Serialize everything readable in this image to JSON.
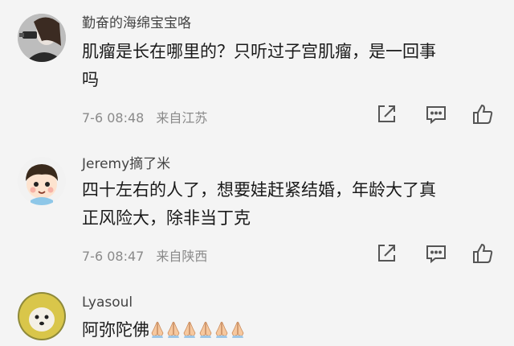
{
  "comments": [
    {
      "username": "勤奋的海绵宝宝咯",
      "text_line1": "肌瘤是长在哪里的？只听过子宫肌瘤，是一回事",
      "text_line2": "吗",
      "time": "7-6 08:48",
      "location": "来自江苏"
    },
    {
      "username": "Jeremy摘了米",
      "text_line1": "四十左右的人了，想要娃赶紧结婚，年龄大了真",
      "text_line2": "正风险大，除非当丁克",
      "time": "7-6 08:47",
      "location": "来自陕西"
    },
    {
      "username": "Lyasoul",
      "text_line1": "阿弥陀佛",
      "emoji_name": "praying-hands-icon",
      "emoji_count": 6
    }
  ],
  "icons": [
    "share-icon",
    "comment-icon",
    "like-icon"
  ],
  "colors": {
    "background": "#f4f4f4",
    "text": "#1a1a1a",
    "meta": "#8a8a8a",
    "icon": "#555555"
  }
}
